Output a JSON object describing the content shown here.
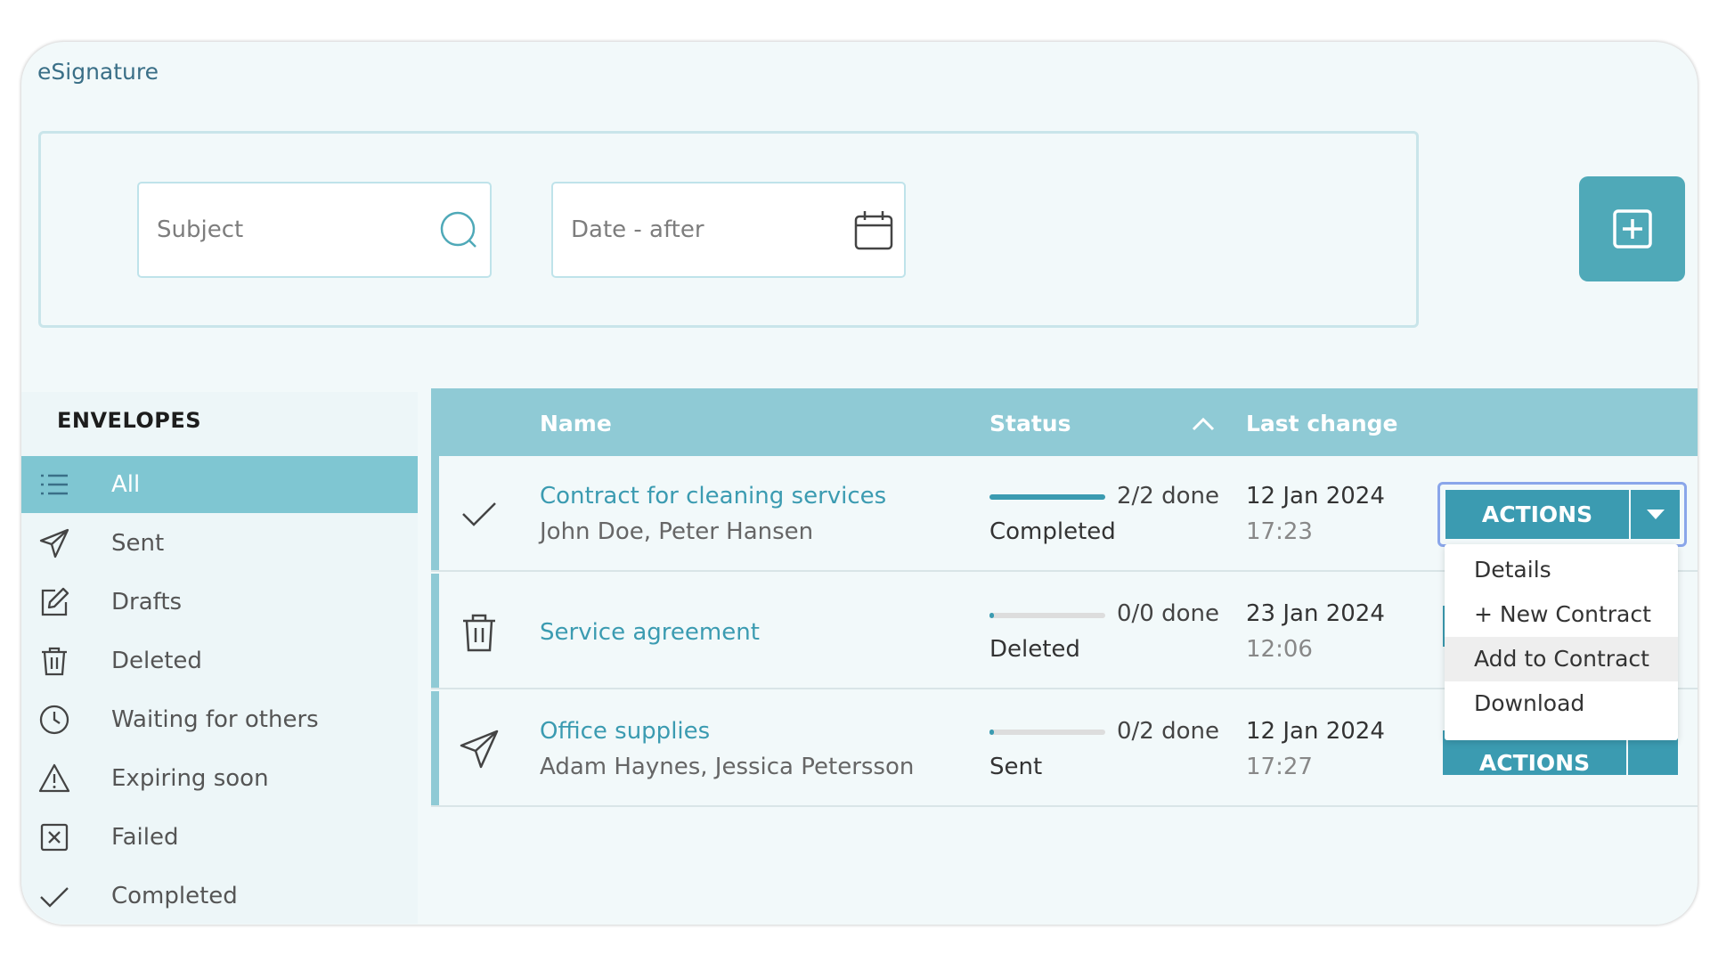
{
  "app": {
    "title": "eSignature"
  },
  "filters": {
    "subject_placeholder": "Subject",
    "date_placeholder": "Date - after"
  },
  "sidebar": {
    "title": "ENVELOPES",
    "items": [
      {
        "label": "All",
        "icon": "list-icon",
        "active": true
      },
      {
        "label": "Sent",
        "icon": "send-icon"
      },
      {
        "label": "Drafts",
        "icon": "edit-icon"
      },
      {
        "label": "Deleted",
        "icon": "trash-icon"
      },
      {
        "label": "Waiting for others",
        "icon": "clock-icon"
      },
      {
        "label": "Expiring soon",
        "icon": "warning-icon"
      },
      {
        "label": "Failed",
        "icon": "x-box-icon"
      },
      {
        "label": "Completed",
        "icon": "check-icon"
      }
    ]
  },
  "table": {
    "columns": {
      "name": "Name",
      "status": "Status",
      "last_change": "Last change"
    },
    "rows": [
      {
        "icon": "check-icon",
        "name": "Contract for cleaning services",
        "recipients": "John Doe, Peter Hansen",
        "progress": "2/2 done",
        "progress_fraction": 1.0,
        "status": "Completed",
        "date": "12 Jan 2024",
        "time": "17:23"
      },
      {
        "icon": "trash-icon",
        "name": "Service agreement",
        "recipients": "",
        "progress": "0/0 done",
        "progress_fraction": 0.0,
        "status": "Deleted",
        "date": "23 Jan 2024",
        "time": "12:06"
      },
      {
        "icon": "send-icon",
        "name": "Office supplies",
        "recipients": "Adam Haynes, Jessica Petersson",
        "progress": "0/2 done",
        "progress_fraction": 0.0,
        "status": "Sent",
        "date": "12 Jan 2024",
        "time": "17:27"
      }
    ]
  },
  "actions": {
    "label": "ACTIONS",
    "menu": [
      "Details",
      "+ New Contract",
      "Add to Contract",
      "Download"
    ],
    "hovered": "Add to Contract"
  },
  "colors": {
    "accent": "#3b9bb1",
    "header": "#8fcad5",
    "active": "#7fc6d2"
  }
}
